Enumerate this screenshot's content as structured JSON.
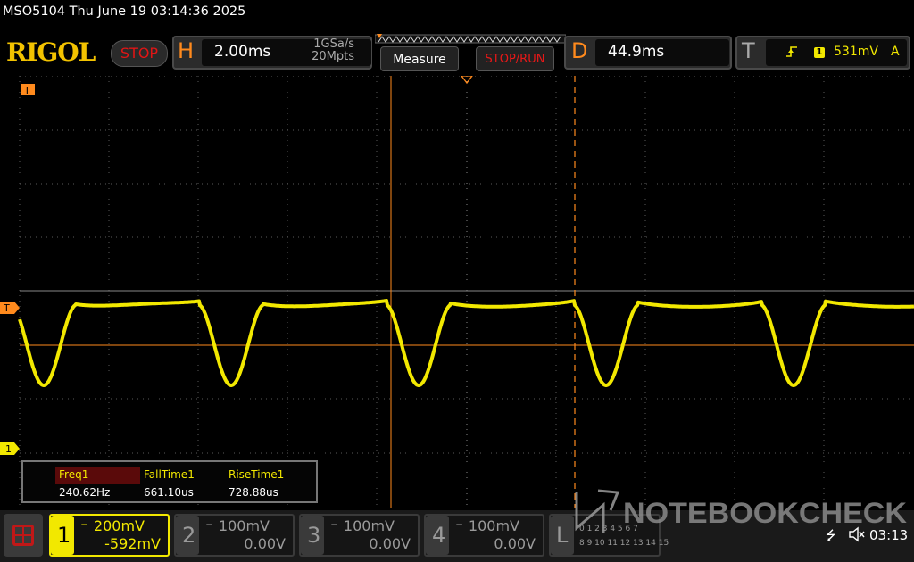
{
  "window": {
    "title": "MSO5104  Thu June 19 03:14:36 2025"
  },
  "brand": "RIGOL",
  "run_state": "STOP",
  "horizontal": {
    "letter": "H",
    "scale": "2.00ms",
    "sample_rate": "1GSa/s",
    "memory_depth": "20Mpts"
  },
  "buttons": {
    "measure": "Measure",
    "stop_run": "STOP/RUN"
  },
  "delay": {
    "letter": "D",
    "value": "44.9ms"
  },
  "trigger": {
    "letter": "T",
    "source": "1",
    "level": "531mV",
    "mode": "A"
  },
  "markers": {
    "trigger_top": "T",
    "trigger_level": "T",
    "ch1_ground": "1"
  },
  "measurements": [
    {
      "name": "Freq1",
      "value": "240.62Hz"
    },
    {
      "name": "FallTime1",
      "value": "661.10us"
    },
    {
      "name": "RiseTime1",
      "value": "728.88us"
    }
  ],
  "channels": [
    {
      "num": "1",
      "scale": "200mV",
      "offset": "-592mV",
      "active": true,
      "color": "#f2e800"
    },
    {
      "num": "2",
      "scale": "100mV",
      "offset": "0.00V",
      "active": false,
      "color": "#9a9a9a"
    },
    {
      "num": "3",
      "scale": "100mV",
      "offset": "0.00V",
      "active": false,
      "color": "#9a9a9a"
    },
    {
      "num": "4",
      "scale": "100mV",
      "offset": "0.00V",
      "active": false,
      "color": "#9a9a9a"
    }
  ],
  "logic": {
    "letter": "L",
    "row1": "0 1 2 3 4 5 6 7",
    "row2": "8 9 10 11 12 13 14 15"
  },
  "watermark": "NOTEBOOKCHECK",
  "status": {
    "time": "03:13"
  },
  "colors": {
    "trace": "#f2e800",
    "cursor": "#ff8a1d",
    "accent": "#ff8a1d",
    "stop": "#e01515"
  }
}
